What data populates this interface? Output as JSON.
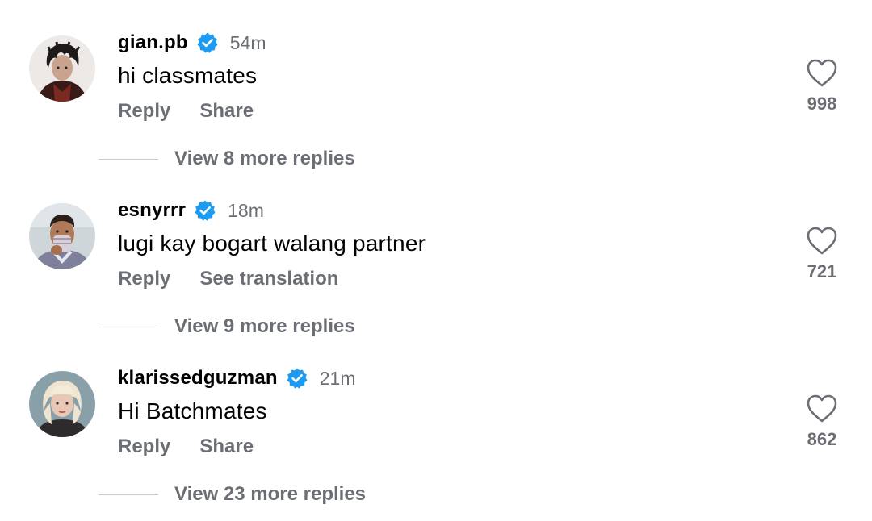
{
  "comments": [
    {
      "avatar": "avatar-dark-hair-portrait",
      "username": "gian.pb",
      "verified": true,
      "time": "54m",
      "text": "hi classmates",
      "actions": [
        "Reply",
        "Share"
      ],
      "likes": "998",
      "view_replies": "View 8 more replies"
    },
    {
      "avatar": "avatar-man-covering-face",
      "username": "esnyrrr",
      "verified": true,
      "time": "18m",
      "text": "lugi kay bogart walang partner",
      "actions": [
        "Reply",
        "See translation"
      ],
      "likes": "721",
      "view_replies": "View 9 more replies"
    },
    {
      "avatar": "avatar-blonde-woman-portrait",
      "username": "klarissedguzman",
      "verified": true,
      "time": "21m",
      "text": "Hi Batchmates",
      "actions": [
        "Reply",
        "Share"
      ],
      "likes": "862",
      "view_replies": "View 23 more replies"
    }
  ],
  "colors": {
    "verified_blue": "#1d9bf0",
    "secondary_text": "#6b6f75",
    "divider": "#c9cbcf"
  },
  "icons": {
    "verified": "verified-badge-icon",
    "like": "heart-outline-icon"
  }
}
